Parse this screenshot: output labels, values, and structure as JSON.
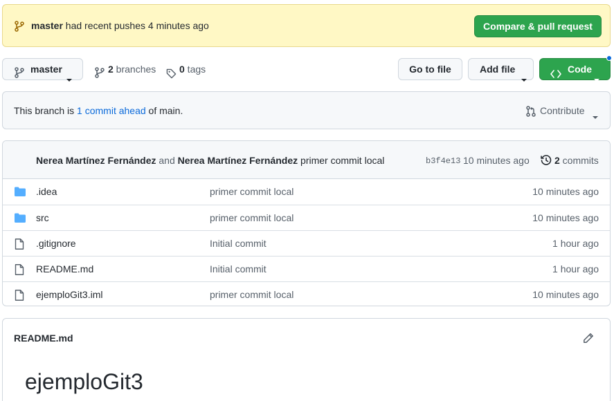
{
  "banner": {
    "branch_name": "master",
    "message": " had recent pushes 4 minutes ago",
    "compare_label": "Compare & pull request"
  },
  "toolbar": {
    "branch_label": "master",
    "branches_count": "2",
    "branches_label": " branches",
    "tags_count": "0",
    "tags_label": " tags",
    "goto_label": "Go to file",
    "addfile_label": "Add file",
    "code_label": "Code"
  },
  "ahead": {
    "prefix": "This branch is ",
    "link": "1 commit ahead",
    "suffix": " of main.",
    "contribute_label": "Contribute"
  },
  "latest_commit": {
    "author1": "Nerea Martínez Fernández",
    "and": " and ",
    "author2": "Nerea Martínez Fernández",
    "message": " primer commit local",
    "sha": "b3f4e13",
    "when": "10 minutes ago",
    "commits_count": "2",
    "commits_label": " commits"
  },
  "files": [
    {
      "name": ".idea",
      "type": "folder",
      "message": "primer commit local",
      "age": "10 minutes ago"
    },
    {
      "name": "src",
      "type": "folder",
      "message": "primer commit local",
      "age": "10 minutes ago"
    },
    {
      "name": ".gitignore",
      "type": "file",
      "message": "Initial commit",
      "age": "1 hour ago"
    },
    {
      "name": "README.md",
      "type": "file",
      "message": "Initial commit",
      "age": "1 hour ago"
    },
    {
      "name": "ejemploGit3.iml",
      "type": "file",
      "message": "primer commit local",
      "age": "10 minutes ago"
    }
  ],
  "readme": {
    "header": "README.md",
    "title": "ejemploGit3"
  },
  "colors": {
    "green": "#2da44e",
    "link_blue": "#0969da",
    "folder_blue": "#54aeff",
    "banner_bg": "#fff8c5"
  }
}
